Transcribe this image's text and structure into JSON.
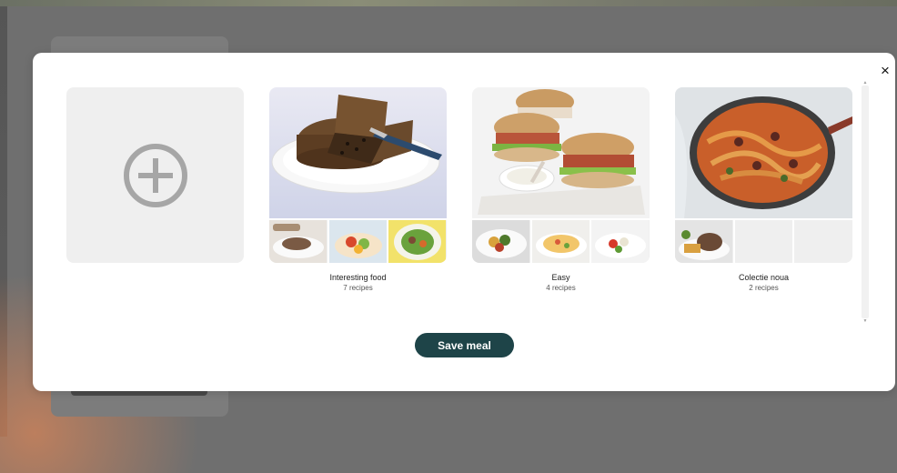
{
  "modal": {
    "close_label": "×",
    "create_tile_icon": "plus-circle-icon",
    "save_button_label": "Save meal"
  },
  "collections": [
    {
      "name": "Interesting food",
      "count": "7 recipes",
      "image": "fruit-cake",
      "thumbs": [
        "steak-plate",
        "tortilla-wrap",
        "green-salad"
      ]
    },
    {
      "name": "Easy",
      "count": "4 recipes",
      "image": "chicken-burgers",
      "thumbs": [
        "roast-vegetables",
        "pasta-salad",
        "tomato-salad"
      ]
    },
    {
      "name": "Colectie noua",
      "count": "2 recipes",
      "image": "spaghetti-pan",
      "thumbs": [
        "meat-plate",
        "",
        ""
      ]
    }
  ],
  "colors": {
    "save_button": "#1e4448",
    "placeholder_tile": "#efefef",
    "overlay": "#6f6f6f"
  }
}
